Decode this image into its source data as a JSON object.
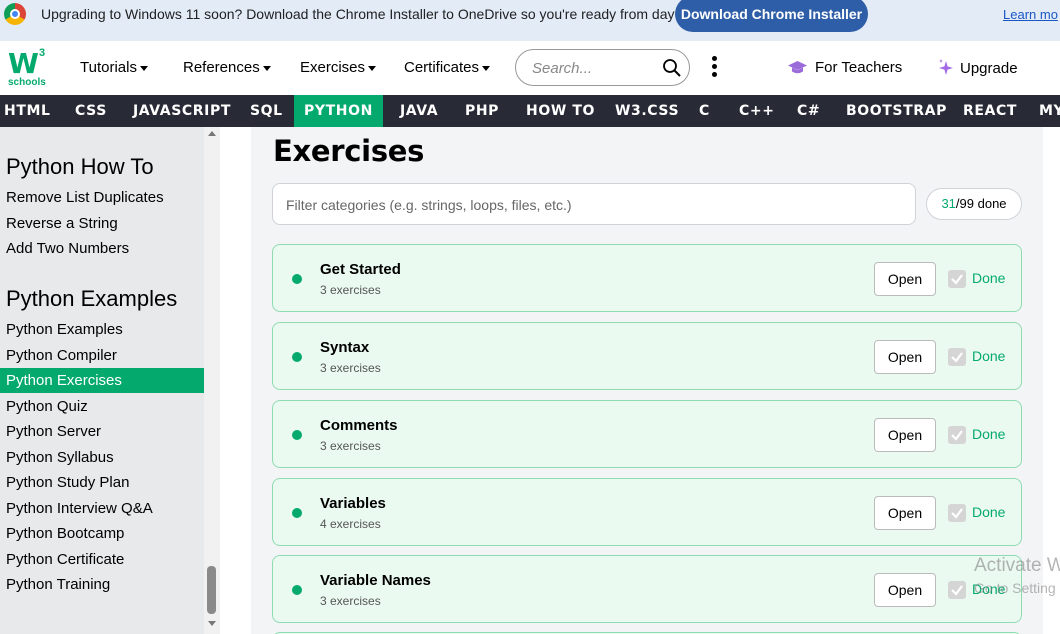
{
  "banner": {
    "text": "Upgrading to Windows 11 soon? Download the Chrome Installer to OneDrive so you're ready from day one.",
    "button": "Download Chrome Installer",
    "link": "Learn mo"
  },
  "header": {
    "logo_mark": "W",
    "logo_superscript": "3",
    "logo_text": "schools",
    "nav": [
      "Tutorials",
      "References",
      "Exercises",
      "Certificates"
    ],
    "search_placeholder": "Search...",
    "teachers": "For Teachers",
    "upgrade": "Upgrade"
  },
  "topnav": {
    "items": [
      "HTML",
      "CSS",
      "JAVASCRIPT",
      "SQL",
      "PYTHON",
      "JAVA",
      "PHP",
      "HOW TO",
      "W3.CSS",
      "C",
      "C++",
      "C#",
      "BOOTSTRAP",
      "REACT",
      "MY"
    ],
    "active": "PYTHON"
  },
  "sidebar": {
    "howto_heading": "Python How To",
    "howto_items": [
      "Remove List Duplicates",
      "Reverse a String",
      "Add Two Numbers"
    ],
    "examples_heading": "Python Examples",
    "examples_items": [
      "Python Examples",
      "Python Compiler",
      "Python Exercises",
      "Python Quiz",
      "Python Server",
      "Python Syllabus",
      "Python Study Plan",
      "Python Interview Q&A",
      "Python Bootcamp",
      "Python Certificate",
      "Python Training"
    ],
    "active_item": "Python Exercises"
  },
  "main": {
    "title": "Exercises",
    "filter_placeholder": "Filter categories (e.g. strings, loops, files, etc.)",
    "done_count": "31",
    "done_total": "/99 done",
    "open_label": "Open",
    "done_label": "Done",
    "categories": [
      {
        "title": "Get Started",
        "count": "3 exercises",
        "done": true
      },
      {
        "title": "Syntax",
        "count": "3 exercises",
        "done": true
      },
      {
        "title": "Comments",
        "count": "3 exercises",
        "done": true
      },
      {
        "title": "Variables",
        "count": "4 exercises",
        "done": true
      },
      {
        "title": "Variable Names",
        "count": "3 exercises",
        "done": true
      }
    ]
  },
  "watermark": {
    "line1": "Activate W",
    "line2": "Go to Setting"
  },
  "colors": {
    "brand_green": "#04aa6d",
    "topnav_bg": "#282a35",
    "banner_bg": "#e3ecf6",
    "banner_button": "#2f5ea8",
    "card_bg": "#ebfaf1"
  }
}
